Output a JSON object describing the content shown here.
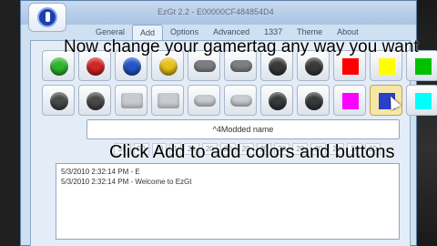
{
  "window": {
    "title": "EzGt 2.2 - E00000CF484854D4"
  },
  "tabs": [
    {
      "label": "General"
    },
    {
      "label": "Add"
    },
    {
      "label": "Options"
    },
    {
      "label": "Advanced"
    },
    {
      "label": "1337"
    },
    {
      "label": "Theme"
    },
    {
      "label": "About"
    }
  ],
  "row1": [
    {
      "kind": "button",
      "label": "green-button",
      "color": "#2fb82f"
    },
    {
      "kind": "button",
      "label": "red-button",
      "color": "#d52626"
    },
    {
      "kind": "button",
      "label": "blue-button",
      "color": "#2456c9"
    },
    {
      "kind": "button",
      "label": "yellow-button",
      "color": "#e8c21a"
    },
    {
      "kind": "pill",
      "label": "back-button",
      "color": "#7c7f84"
    },
    {
      "kind": "pill",
      "label": "start-button",
      "color": "#7c7f84"
    },
    {
      "kind": "stick",
      "label": "left-stick",
      "color": "#3a3a3a"
    },
    {
      "kind": "stick",
      "label": "right-stick",
      "color": "#3a3a3a"
    },
    {
      "kind": "swatch",
      "label": "color-red",
      "color": "#ff0000"
    },
    {
      "kind": "swatch",
      "label": "color-yellow",
      "color": "#ffff00"
    },
    {
      "kind": "swatch",
      "label": "color-green",
      "color": "#00c000"
    }
  ],
  "row2": [
    {
      "kind": "stick",
      "label": "dpad-left",
      "color": "#4a4a4a"
    },
    {
      "kind": "stick",
      "label": "dpad-right",
      "color": "#4a4a4a"
    },
    {
      "kind": "rect",
      "label": "left-trigger",
      "color": "#c8ccd2"
    },
    {
      "kind": "rect",
      "label": "right-trigger",
      "color": "#c8ccd2"
    },
    {
      "kind": "pill",
      "label": "left-bumper",
      "color": "#c8ccd2"
    },
    {
      "kind": "pill",
      "label": "right-bumper",
      "color": "#c8ccd2"
    },
    {
      "kind": "stick",
      "label": "xbox-guide",
      "color": "#3a3a3a"
    },
    {
      "kind": "stick",
      "label": "stick-click",
      "color": "#3a3a3a"
    },
    {
      "kind": "swatch",
      "label": "color-magenta",
      "color": "#ff00ff"
    },
    {
      "kind": "swatch",
      "label": "color-blue",
      "color": "#2a40c8",
      "selected": true
    },
    {
      "kind": "swatch",
      "label": "color-cyan",
      "color": "#00ffff"
    }
  ],
  "name_field": {
    "value": "^4Modded name"
  },
  "faded_row": [
    "SE",
    "50",
    "40",
    "1",
    "20",
    "20",
    "20",
    "20",
    "20",
    "20",
    "20",
    "20",
    "20",
    "20",
    "20"
  ],
  "log": [
    "5/3/2010 2:32:14 PM - E",
    "5/3/2010 2:32:14 PM - Welcome to EzGt"
  ],
  "overlay": {
    "caption_top": "Now change your gamertag any way you want",
    "caption_bottom": "Click Add to add colors and buttons"
  }
}
